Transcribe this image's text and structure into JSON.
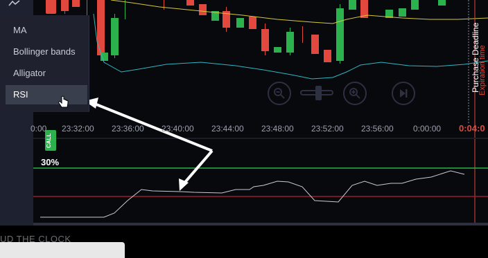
{
  "menu": {
    "items": [
      {
        "label": "MA"
      },
      {
        "label": "Bollinger bands"
      },
      {
        "label": "Alligator"
      },
      {
        "label": "RSI",
        "active": true
      }
    ]
  },
  "call_button": {
    "label": "CALL"
  },
  "time_axis": {
    "labels": [
      "0:00",
      "23:32:00",
      "23:36:00",
      "23:40:00",
      "23:44:00",
      "23:48:00",
      "23:52:00",
      "23:56:00",
      "0:00:00"
    ]
  },
  "timer": "0:04:0",
  "rsi_level": "30%",
  "purchase_deadline": "Purchase Deadline",
  "expiration_time": "Expiration time",
  "bottom_text": "UD THE CLOCK",
  "colors": {
    "bull": "#2bb24c",
    "bear": "#e2483d",
    "bb_upper": "#d8c83a",
    "bb_lower": "#2fb8c4",
    "rsi_upper": "#2bb24c",
    "rsi_lower": "#9b1c2b"
  }
}
